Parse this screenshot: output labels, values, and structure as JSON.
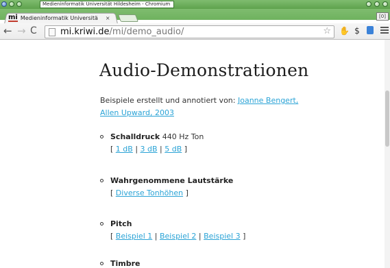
{
  "window": {
    "title": "Medieninformatik Universität Hildesheim - Chromium"
  },
  "tab": {
    "favicon_text": "mi",
    "label": "Medieninformatik Universitä",
    "close": "×",
    "corner_label": "[0]"
  },
  "toolbar": {
    "back": "←",
    "forward": "→",
    "reload": "C",
    "url_host": "mi.kriwi.de",
    "url_path": "/mi/demo_audio/",
    "star": "☆"
  },
  "page": {
    "heading": "Audio-Demonstrationen",
    "byline_prefix": "Beispiele erstellt und annotiert von: ",
    "byline_link": "Joanne Bengert, Allen Upward, 2003",
    "items": [
      {
        "title_bold": "Schalldruck",
        "title_rest": " 440 Hz Ton",
        "open": "[ ",
        "links": [
          "1 dB",
          "3 dB",
          "5 dB"
        ],
        "sep": " | ",
        "close": " ]"
      },
      {
        "title_bold": "Wahrgenommene Lautstärke",
        "title_rest": "",
        "open": "[ ",
        "links": [
          "Diverse Tonhöhen"
        ],
        "sep": " | ",
        "close": " ]"
      },
      {
        "title_bold": "Pitch",
        "title_rest": "",
        "open": "[ ",
        "links": [
          "Beispiel 1",
          "Beispiel 2",
          "Beispiel 3"
        ],
        "sep": " | ",
        "close": " ]"
      },
      {
        "title_bold": "Timbre",
        "title_rest": ""
      }
    ]
  }
}
